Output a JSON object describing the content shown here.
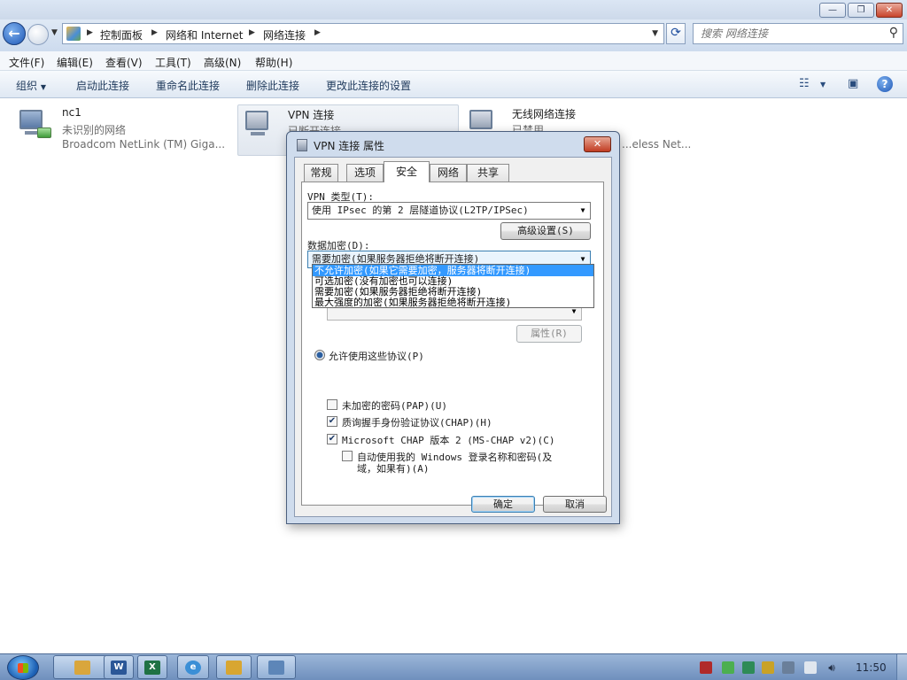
{
  "window": {
    "min_icon": "minimize-icon",
    "max_icon": "maximize-icon",
    "close_icon": "close-icon"
  },
  "address": {
    "crumbs": [
      "控制面板",
      "网络和 Internet",
      "网络连接"
    ],
    "search_placeholder": "搜索 网络连接"
  },
  "menubar": {
    "items": [
      "文件(F)",
      "编辑(E)",
      "查看(V)",
      "工具(T)",
      "高级(N)",
      "帮助(H)"
    ]
  },
  "commandbar": {
    "organize": "组织",
    "start": "启动此连接",
    "rename": "重命名此连接",
    "delete": "删除此连接",
    "change": "更改此连接的设置"
  },
  "connections": [
    {
      "name": "nc1",
      "status": "未识别的网络",
      "adapter": "Broadcom NetLink (TM) Giga..."
    },
    {
      "name": "VPN 连接",
      "status": "已断开连接",
      "adapter": ""
    },
    {
      "name": "无线网络连接",
      "status": "已禁用",
      "adapter": "...eless Net..."
    }
  ],
  "dialog": {
    "title": "VPN 连接 属性",
    "close": "✕",
    "tabs": [
      "常规",
      "选项",
      "安全",
      "网络",
      "共享"
    ],
    "active_tab": "安全",
    "vpn_type_label": "VPN 类型(T):",
    "vpn_type_value": "使用 IPsec 的第 2 层隧道协议(L2TP/IPSec)",
    "advanced_button": "高级设置(S)",
    "encryption_label": "数据加密(D):",
    "encryption_value": "需要加密(如果服务器拒绝将断开连接)",
    "encryption_options": [
      "不允许加密(如果它需要加密，服务器将断开连接)",
      "可选加密(没有加密也可以连接)",
      "需要加密(如果服务器拒绝将断开连接)",
      "最大强度的加密(如果服务器拒绝将断开连接)"
    ],
    "properties_button": "属性(R)",
    "allow_protocols": "允许使用这些协议(P)",
    "protocols": [
      {
        "label": "未加密的密码(PAP)(U)",
        "checked": false
      },
      {
        "label": "质询握手身份验证协议(CHAP)(H)",
        "checked": true
      },
      {
        "label": "Microsoft CHAP 版本 2 (MS-CHAP v2)(C)",
        "checked": true
      }
    ],
    "auto_windows_line1": "自动使用我的 Windows 登录名称和密码(及",
    "auto_windows_line2": "域，如果有)(A)",
    "ok": "确定",
    "cancel": "取消"
  },
  "taskbar": {
    "clock": "11:50"
  }
}
